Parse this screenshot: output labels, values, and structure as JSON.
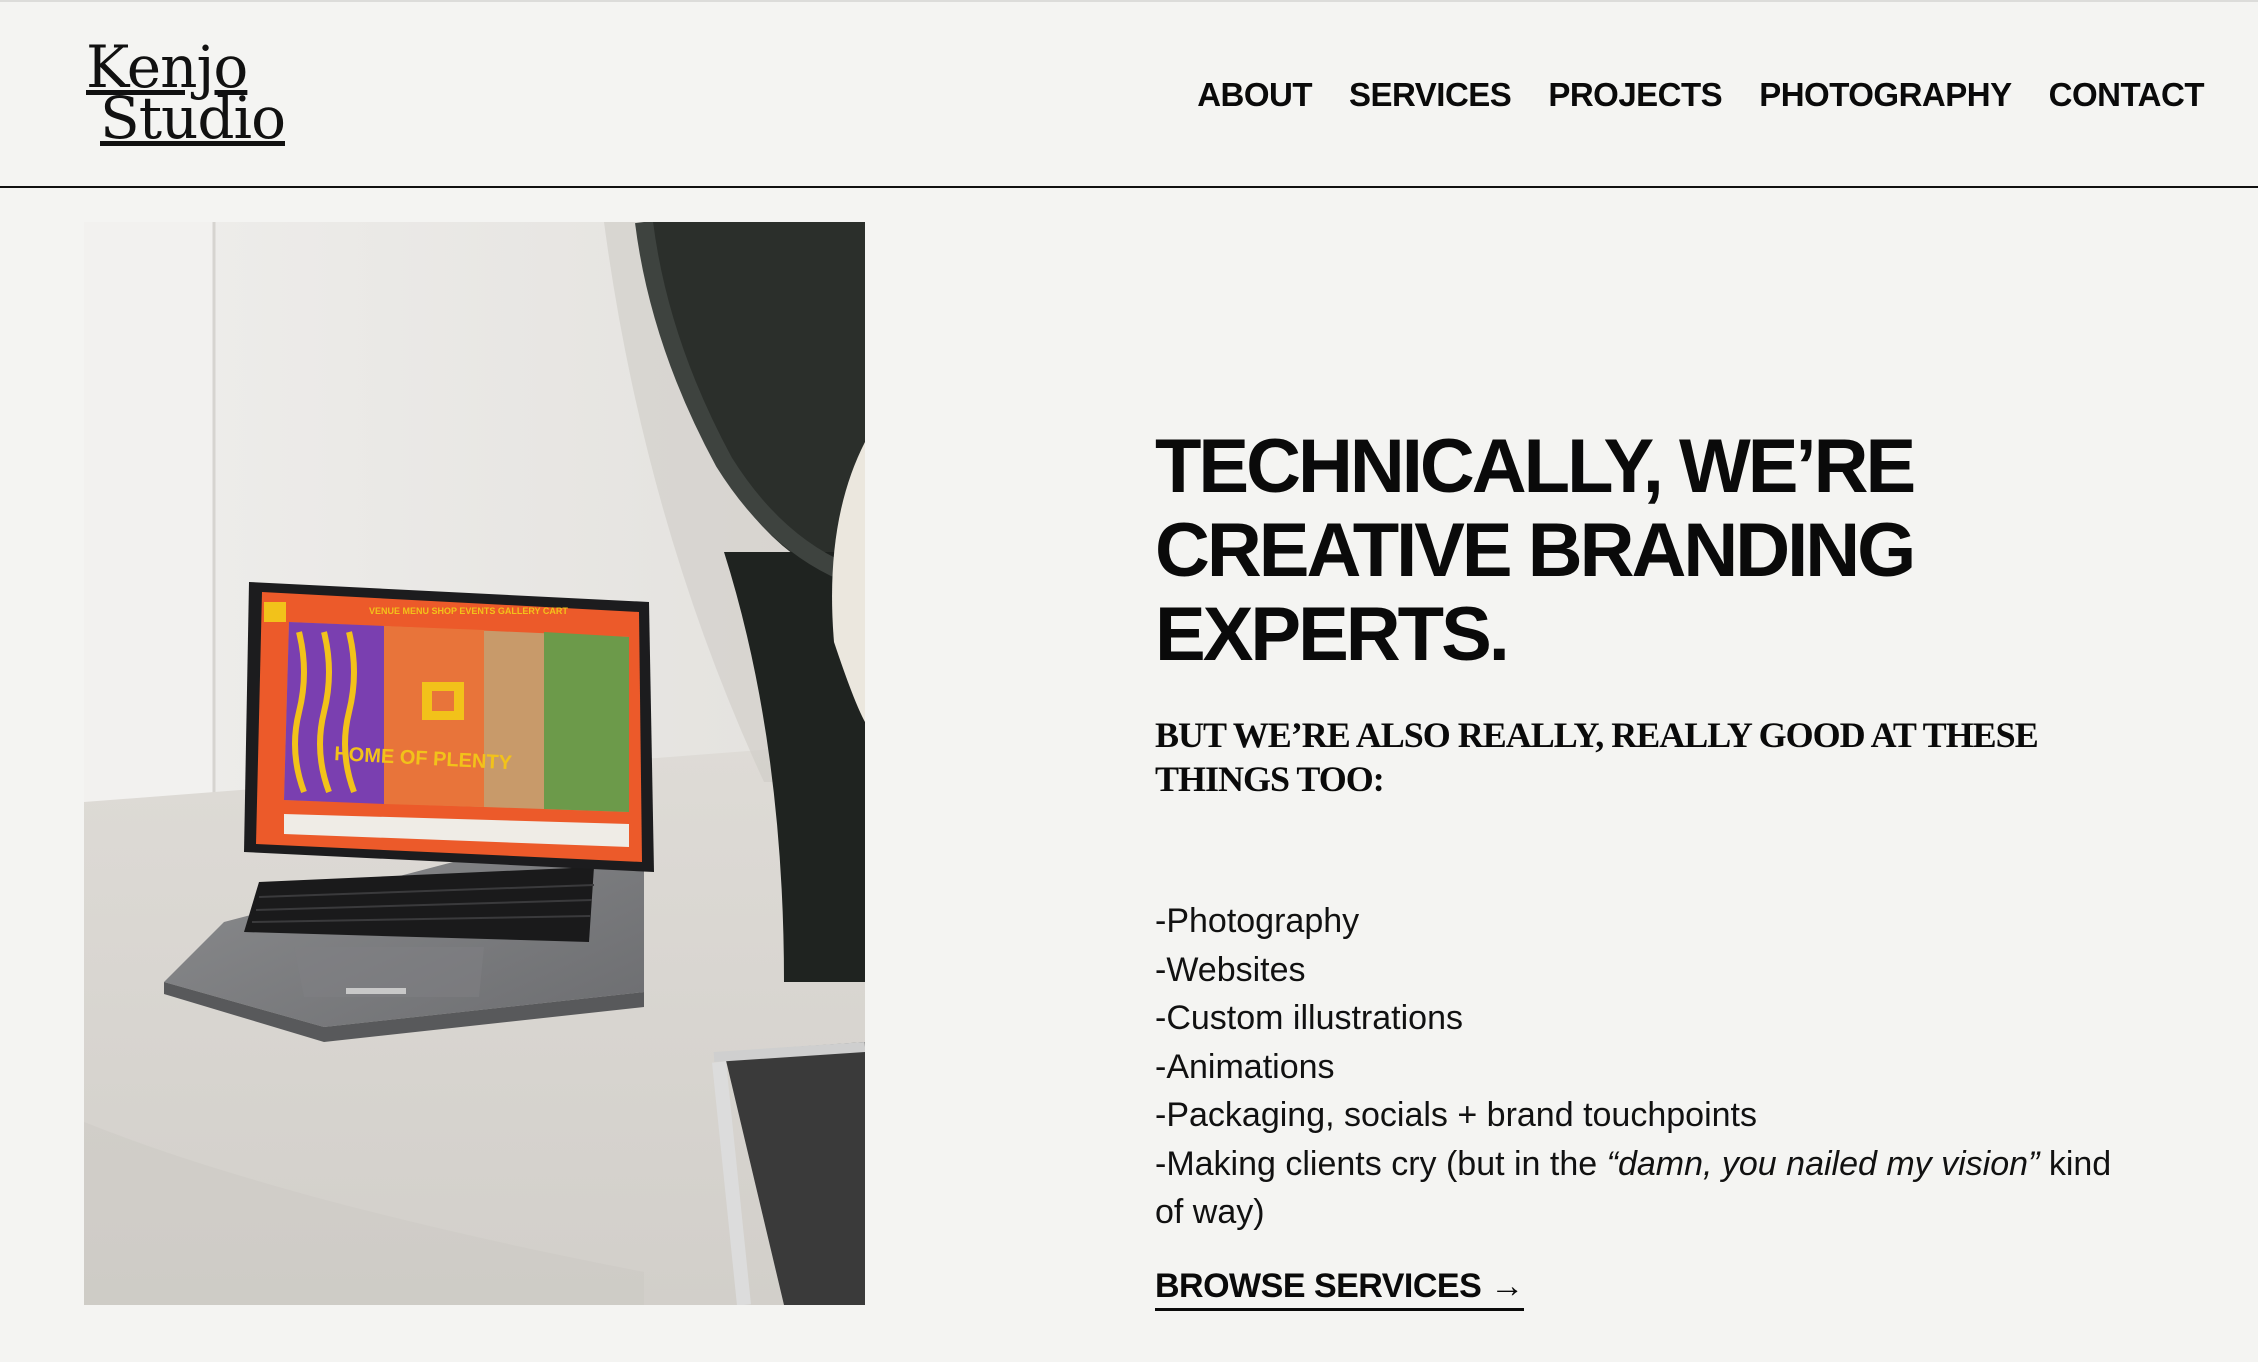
{
  "brand": {
    "logo_line1": "Kenjo",
    "logo_line2": "Studio"
  },
  "nav": {
    "items": [
      {
        "label": "ABOUT"
      },
      {
        "label": "SERVICES"
      },
      {
        "label": "PROJECTS"
      },
      {
        "label": "PHOTOGRAPHY"
      },
      {
        "label": "CONTACT"
      }
    ]
  },
  "photo": {
    "screen_nav": "VENUE  MENU  SHOP  EVENTS  GALLERY  CART",
    "screen_title": "HOME OF PLENTY",
    "screen_accent_color": "#ec5a2a",
    "screen_text_color": "#f2c21a"
  },
  "hero": {
    "headline": "TECHNICALLY, WE’RE CREATIVE BRANDING EXPERTS.",
    "subhead": "BUT WE’RE ALSO REALLY, REALLY GOOD AT THESE THINGS TOO:",
    "services": [
      "-Photography",
      "-Websites",
      "-Custom illustrations",
      "-Animations",
      "-Packaging, socials + brand touchpoints"
    ],
    "last_item_prefix": "-Making clients cry (but in the ",
    "last_item_quote": "“damn, you nailed my vision”",
    "last_item_suffix": " kind of way)",
    "cta_label": "BROWSE SERVICES →"
  }
}
